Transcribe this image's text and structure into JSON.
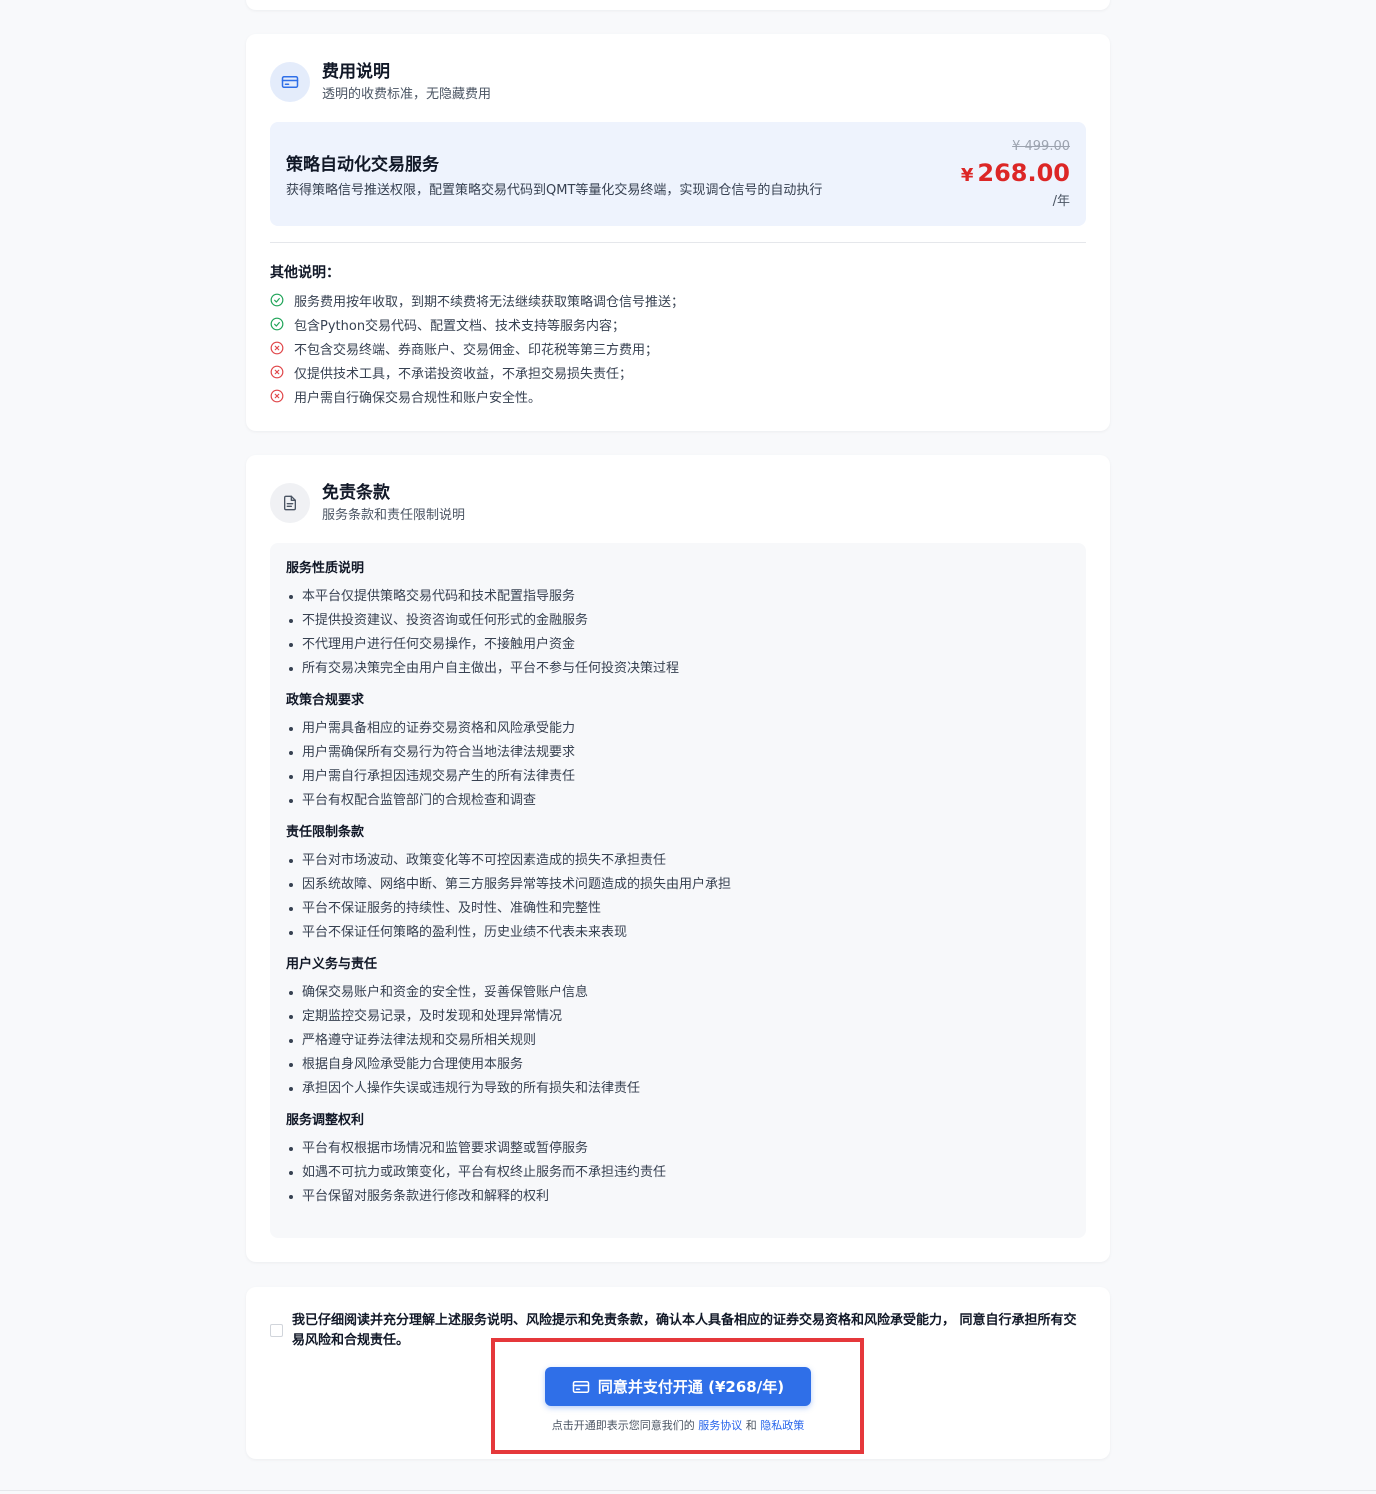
{
  "fee": {
    "title": "费用说明",
    "subtitle": "透明的收费标准，无隐藏费用",
    "service": {
      "name": "策略自动化交易服务",
      "description": "获得策略信号推送权限，配置策略交易代码到QMT等量化交易终端，实现调仓信号的自动执行",
      "original_price": "¥ 499.00",
      "currency": "¥",
      "price": "268.00",
      "unit": "/年"
    },
    "other_title": "其他说明：",
    "other_items": [
      {
        "status": "check",
        "text": "服务费用按年收取，到期不续费将无法继续获取策略调仓信号推送；"
      },
      {
        "status": "check",
        "text": "包含Python交易代码、配置文档、技术支持等服务内容；"
      },
      {
        "status": "cross",
        "text": "不包含交易终端、券商账户、交易佣金、印花税等第三方费用；"
      },
      {
        "status": "cross",
        "text": "仅提供技术工具，不承诺投资收益，不承担交易损失责任；"
      },
      {
        "status": "cross",
        "text": "用户需自行确保交易合规性和账户安全性。"
      }
    ],
    "colors": {
      "check": "#22a55a",
      "cross": "#e0484b"
    }
  },
  "terms": {
    "title": "免责条款",
    "subtitle": "服务条款和责任限制说明",
    "sections": [
      {
        "title": "服务性质说明",
        "items": [
          "本平台仅提供策略交易代码和技术配置指导服务",
          "不提供投资建议、投资咨询或任何形式的金融服务",
          "不代理用户进行任何交易操作，不接触用户资金",
          "所有交易决策完全由用户自主做出，平台不参与任何投资决策过程"
        ]
      },
      {
        "title": "政策合规要求",
        "items": [
          "用户需具备相应的证券交易资格和风险承受能力",
          "用户需确保所有交易行为符合当地法律法规要求",
          "用户需自行承担因违规交易产生的所有法律责任",
          "平台有权配合监管部门的合规检查和调查"
        ]
      },
      {
        "title": "责任限制条款",
        "items": [
          "平台对市场波动、政策变化等不可控因素造成的损失不承担责任",
          "因系统故障、网络中断、第三方服务异常等技术问题造成的损失由用户承担",
          "平台不保证服务的持续性、及时性、准确性和完整性",
          "平台不保证任何策略的盈利性，历史业绩不代表未来表现"
        ]
      },
      {
        "title": "用户义务与责任",
        "items": [
          "确保交易账户和资金的安全性，妥善保管账户信息",
          "定期监控交易记录，及时发现和处理异常情况",
          "严格遵守证券法律法规和交易所相关规则",
          "根据自身风险承受能力合理使用本服务",
          "承担因个人操作失误或违规行为导致的所有损失和法律责任"
        ]
      },
      {
        "title": "服务调整权利",
        "items": [
          "平台有权根据市场情况和监管要求调整或暂停服务",
          "如遇不可抗力或政策变化，平台有权终止服务而不承担违约责任",
          "平台保留对服务条款进行修改和解释的权利"
        ]
      }
    ]
  },
  "agreement": {
    "checked": false,
    "text": "我已仔细阅读并充分理解上述服务说明、风险提示和免责条款，确认本人具备相应的证券交易资格和风险承受能力， 同意自行承担所有交易风险和合规责任。",
    "button_label": "同意并支付开通 (¥268/年)",
    "note_prefix": "点击开通即表示您同意我们的",
    "link_service": "服务协议",
    "note_and": "和",
    "link_privacy": "隐私政策"
  },
  "theme": {
    "accent": "#2f6fe8",
    "price_red": "#dc2626",
    "highlight": "#e5383b"
  }
}
